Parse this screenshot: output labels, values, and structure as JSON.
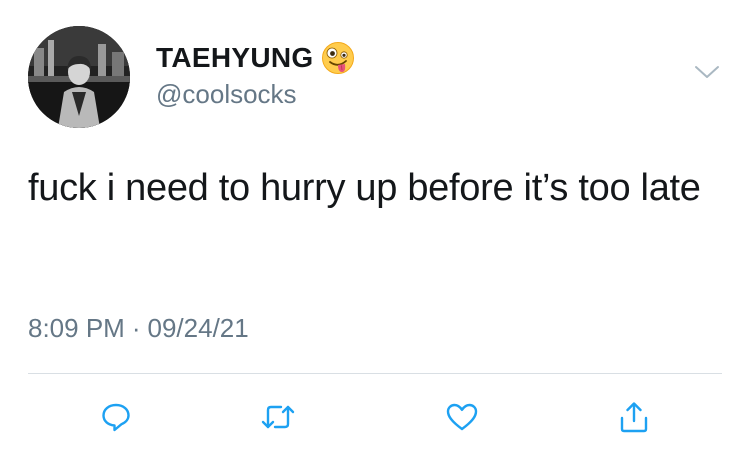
{
  "author": {
    "display_name": "TAEHYUNG",
    "handle": "@coolsocks",
    "name_emoji": "zany-face-emoji"
  },
  "tweet": {
    "text": "fuck i need to hurry up before it’s too late",
    "time": "8:09 PM",
    "separator": "·",
    "date": "09/24/21"
  },
  "icons": {
    "more": "chevron-down-icon",
    "reply": "reply-icon",
    "retweet": "retweet-icon",
    "like": "heart-icon",
    "share": "share-icon"
  },
  "colors": {
    "text": "#14171a",
    "secondary": "#657786",
    "icon": "#1da1f2",
    "divider": "#d9dfe4"
  }
}
